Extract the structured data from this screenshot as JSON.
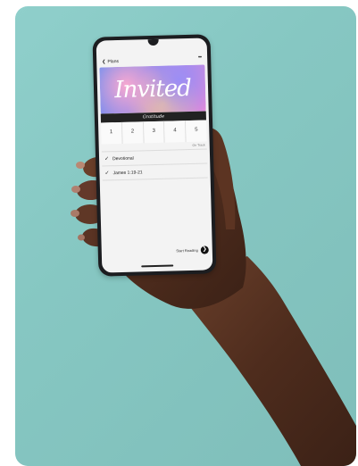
{
  "app": {
    "nav": {
      "back_icon": "chevron-left-icon",
      "title": "Plans",
      "menu_icon": "ellipsis-icon"
    },
    "banner": {
      "title": "Invited"
    },
    "brand": {
      "text": "Gratitude"
    },
    "days": [
      {
        "num": "1",
        "sub": "",
        "active": true
      },
      {
        "num": "2",
        "sub": ""
      },
      {
        "num": "3",
        "sub": ""
      },
      {
        "num": "4",
        "sub": ""
      },
      {
        "num": "5",
        "sub": ""
      }
    ],
    "meta": {
      "left": "",
      "right": "On Track"
    },
    "items": [
      {
        "icon": "checkmark-icon",
        "label": "Devotional"
      },
      {
        "icon": "checkmark-icon",
        "label": "James 1:19-21"
      }
    ],
    "start_reading": {
      "label": "Start Reading",
      "icon": "arrow-right-icon"
    }
  },
  "colors": {
    "background": "#8ccbc7",
    "phone": "#1c1d20",
    "skin": "#5a3524"
  }
}
